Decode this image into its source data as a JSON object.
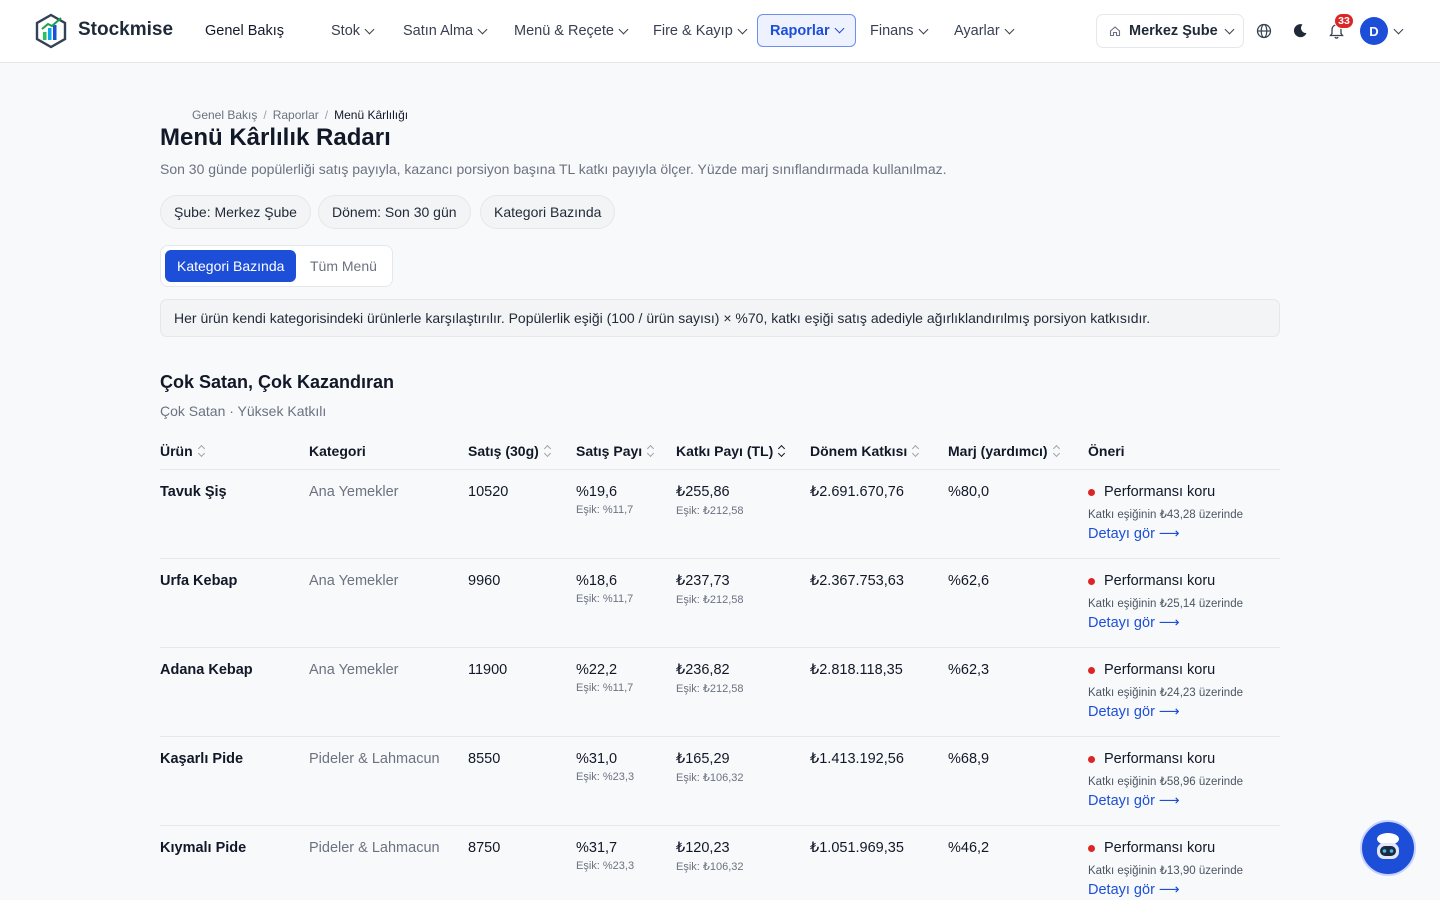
{
  "app": {
    "brand": "Stockmise"
  },
  "nav": {
    "overview": "Genel Bakış",
    "items": [
      {
        "label": "Stok"
      },
      {
        "label": "Satın Alma"
      },
      {
        "label": "Menü & Reçete"
      },
      {
        "label": "Fire & Kayıp"
      },
      {
        "label": "Raporlar",
        "active": true
      },
      {
        "label": "Finans"
      },
      {
        "label": "Ayarlar"
      }
    ],
    "branch": "Merkez Şube",
    "notifications": "33",
    "avatar": "D"
  },
  "breadcrumb": [
    "Genel Bakış",
    "Raporlar",
    "Menü Kârlılığı"
  ],
  "page": {
    "title": "Menü Kârlılık Radarı",
    "description": "Son 30 günde popülerliği satış payıyla, kazancı porsiyon başına TL katkı payıyla ölçer. Yüzde marj sınıflandırmada kullanılmaz."
  },
  "filters": [
    "Şube: Merkez Şube",
    "Dönem: Son 30 gün",
    "Kategori Bazında"
  ],
  "toggle": {
    "selected": "Kategori Bazında",
    "other": "Tüm Menü"
  },
  "info": "Her ürün kendi kategorisindeki ürünlerle karşılaştırılır. Popülerlik eşiği (100 / ürün sayısı) × %70, katkı eşiği satış adediyle ağırlıklandırılmış porsiyon katkısıdır.",
  "section": {
    "title": "Çok Satan, Çok Kazandıran",
    "subtitle": "Çok Satan · Yüksek Katkılı"
  },
  "table": {
    "headers": [
      "Ürün",
      "Kategori",
      "Satış (30g)",
      "Satış Payı",
      "Katkı Payı (TL)",
      "Dönem Katkısı",
      "Marj (yardımcı)",
      "Öneri"
    ],
    "rows": [
      {
        "name": "Tavuk Şiş",
        "category": "Ana Yemekler",
        "sales": "10520",
        "share": "%19,6",
        "share_threshold": "Eşik: %11,7",
        "contribution": "₺255,86",
        "contribution_threshold": "Eşik: ₺212,58",
        "period": "₺2.691.670,76",
        "margin": "%80,0",
        "recommendation": "Performansı koru",
        "note": "Katkı eşiğinin ₺43,28 üzerinde",
        "detail": "Detayı gör ⟶"
      },
      {
        "name": "Urfa Kebap",
        "category": "Ana Yemekler",
        "sales": "9960",
        "share": "%18,6",
        "share_threshold": "Eşik: %11,7",
        "contribution": "₺237,73",
        "contribution_threshold": "Eşik: ₺212,58",
        "period": "₺2.367.753,63",
        "margin": "%62,6",
        "recommendation": "Performansı koru",
        "note": "Katkı eşiğinin ₺25,14 üzerinde",
        "detail": "Detayı gör ⟶"
      },
      {
        "name": "Adana Kebap",
        "category": "Ana Yemekler",
        "sales": "11900",
        "share": "%22,2",
        "share_threshold": "Eşik: %11,7",
        "contribution": "₺236,82",
        "contribution_threshold": "Eşik: ₺212,58",
        "period": "₺2.818.118,35",
        "margin": "%62,3",
        "recommendation": "Performansı koru",
        "note": "Katkı eşiğinin ₺24,23 üzerinde",
        "detail": "Detayı gör ⟶"
      },
      {
        "name": "Kaşarlı Pide",
        "category": "Pideler & Lahmacun",
        "sales": "8550",
        "share": "%31,0",
        "share_threshold": "Eşik: %23,3",
        "contribution": "₺165,29",
        "contribution_threshold": "Eşik: ₺106,32",
        "period": "₺1.413.192,56",
        "margin": "%68,9",
        "recommendation": "Performansı koru",
        "note": "Katkı eşiğinin ₺58,96 üzerinde",
        "detail": "Detayı gör ⟶"
      },
      {
        "name": "Kıymalı Pide",
        "category": "Pideler & Lahmacun",
        "sales": "8750",
        "share": "%31,7",
        "share_threshold": "Eşik: %23,3",
        "contribution": "₺120,23",
        "contribution_threshold": "Eşik: ₺106,32",
        "period": "₺1.051.969,35",
        "margin": "%46,2",
        "recommendation": "Performansı koru",
        "note": "Katkı eşiğinin ₺13,90 üzerinde",
        "detail": "Detayı gör ⟶"
      }
    ]
  },
  "colors": {
    "accent": "#1d4ed8",
    "danger": "#dc2626"
  }
}
